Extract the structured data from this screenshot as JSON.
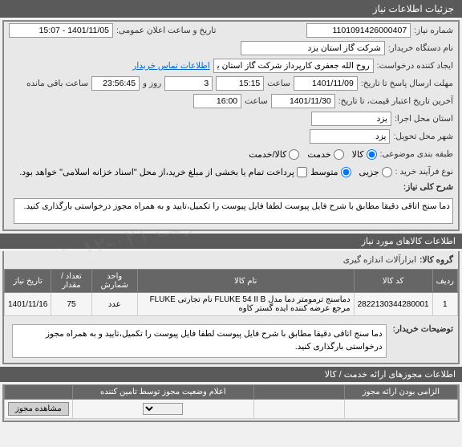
{
  "watermark": "سامانه تدارکات الکترونیکی دولت\n۰۲۱-۸۸۱۲۶۰۱۲",
  "header": {
    "title": "جزئیات اطلاعات نیاز"
  },
  "fields": {
    "need_no_label": "شماره نیاز:",
    "need_no": "1101091426000407",
    "announce_label": "تاریخ و ساعت اعلان عمومی:",
    "announce": "1401/11/05 - 15:07",
    "buyer_label": "نام دستگاه خریدار:",
    "buyer": "شرکت گاز استان یزد",
    "creator_label": "ایجاد کننده درخواست:",
    "creator": "روح الله جعفری کارپرداز شرکت گاز استان یزد",
    "contact_link": "اطلاعات تماس خریدار",
    "deadline_label": "مهلت ارسال پاسخ تا تاریخ:",
    "deadline_date": "1401/11/09",
    "hour_label": "ساعت",
    "deadline_hour": "15:15",
    "day_label": "روز و",
    "day_val": "3",
    "remain": "23:56:45",
    "remain_label": "ساعت باقی مانده",
    "validity_label": "آخرین تاریخ اعتبار قیمت، تا تاریخ:",
    "validity_date": "1401/11/30",
    "validity_hour": "16:00",
    "exec_prov_label": "استان محل اجرا:",
    "exec_prov": "یزد",
    "deliv_city_label": "شهر محل تحویل:",
    "deliv_city": "یزد",
    "subject_cat_label": "طبقه بندی موضوعی:",
    "r_goods": "کالا",
    "r_service": "خدمت",
    "r_goods_service": "کالا/خدمت",
    "purchase_type_label": "نوع فرآیند خرید :",
    "r_small": "جزیی",
    "r_medium": "متوسط",
    "payment_note": "پرداخت تمام یا بخشی از مبلغ خرید،از محل \"اسناد خزانه اسلامی\" خواهد بود.",
    "desc_label": "شرح کلی نیاز:",
    "desc_text": "دما سنج اتاقی دقیقا مطابق با شرح فایل پیوست لطفا فایل پیوست را تکمیل،تایید و به همراه مجوز درخواستی بارگذاری کنید."
  },
  "goods_header": "اطلاعات کالاهای مورد نیاز",
  "group_label": "گروه کالا:",
  "group_val": "ابزارآلات اندازه گیری",
  "table": {
    "headers": [
      "ردیف",
      "کد کالا",
      "نام کالا",
      "واحد شمارش",
      "تعداد / مقدار",
      "تاریخ نیاز"
    ],
    "row": {
      "idx": "1",
      "code": "2822130344280001",
      "name": "دماسنج ترمومتر دما مدل FLUKE 54 II B نام تجارتی FLUKE مرجع عرضه کننده ایده گستر کاوه",
      "unit": "عدد",
      "qty": "75",
      "date": "1401/11/16"
    }
  },
  "buyer_note_label": "توضیحات خریدار:",
  "buyer_note": "دما سنج اتاقی دقیقا مطابق با شرح فایل پیوست لطفا فایل پیوست را تکمیل،تایید و به همراه مجوز درخواستی بارگذاری کنید.",
  "permits_header": "اطلاعات مجوزهای ارائه خدمت / کالا",
  "permits_table": {
    "headers": [
      "الزامی بودن ارائه مجوز",
      "",
      "اعلام وضعیت مجوز توسط تامین کننده",
      ""
    ],
    "view_btn": "مشاهده مجوز"
  }
}
